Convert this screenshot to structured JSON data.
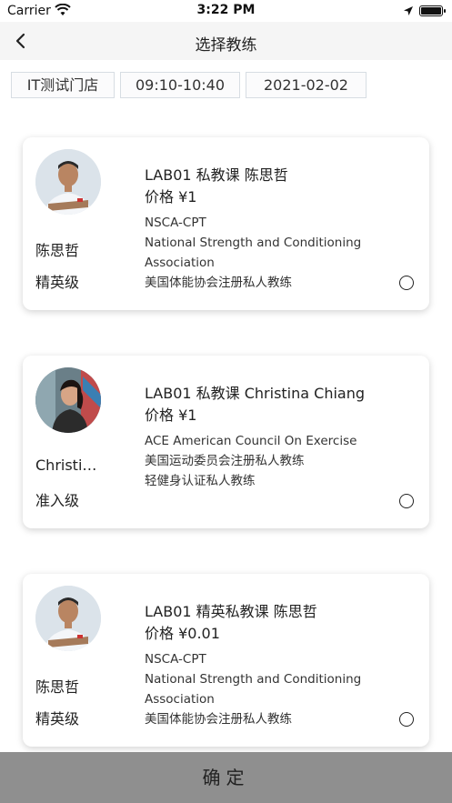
{
  "status_bar": {
    "carrier": "Carrier",
    "time": "3:22 PM"
  },
  "nav": {
    "title": "选择教练",
    "back_icon": "chevron-left-icon"
  },
  "filters": {
    "store": "IT测试门店",
    "time_slot": "09:10-10:40",
    "date": "2021-02-02"
  },
  "coaches": [
    {
      "name": "陈思哲",
      "level": "精英级",
      "course": "LAB01 私教课 陈思哲",
      "price": "价格 ¥1",
      "certs": [
        "NSCA-CPT",
        "National Strength and Conditioning Association",
        "美国体能协会注册私人教练"
      ],
      "avatar": "coach-photo-male"
    },
    {
      "name": "Christina Chiang",
      "level": "准入级",
      "course": "LAB01 私教课 Christina Chiang",
      "price": "价格 ¥1",
      "certs": [
        "ACE American Council On Exercise",
        "美国运动委员会注册私人教练",
        "轻健身认证私人教练"
      ],
      "avatar": "coach-photo-female"
    },
    {
      "name": "陈思哲",
      "level": "精英级",
      "course": "LAB01 精英私教课 陈思哲",
      "price": "价格 ¥0.01",
      "certs": [
        "NSCA-CPT",
        "National Strength and Conditioning Association",
        "美国体能协会注册私人教练"
      ],
      "avatar": "coach-photo-male"
    }
  ],
  "confirm_label": "确定",
  "colors": {
    "nav_bg": "#f5f5f5",
    "confirm_bg": "#8f8f8f",
    "chip_border": "#d7dde3"
  }
}
